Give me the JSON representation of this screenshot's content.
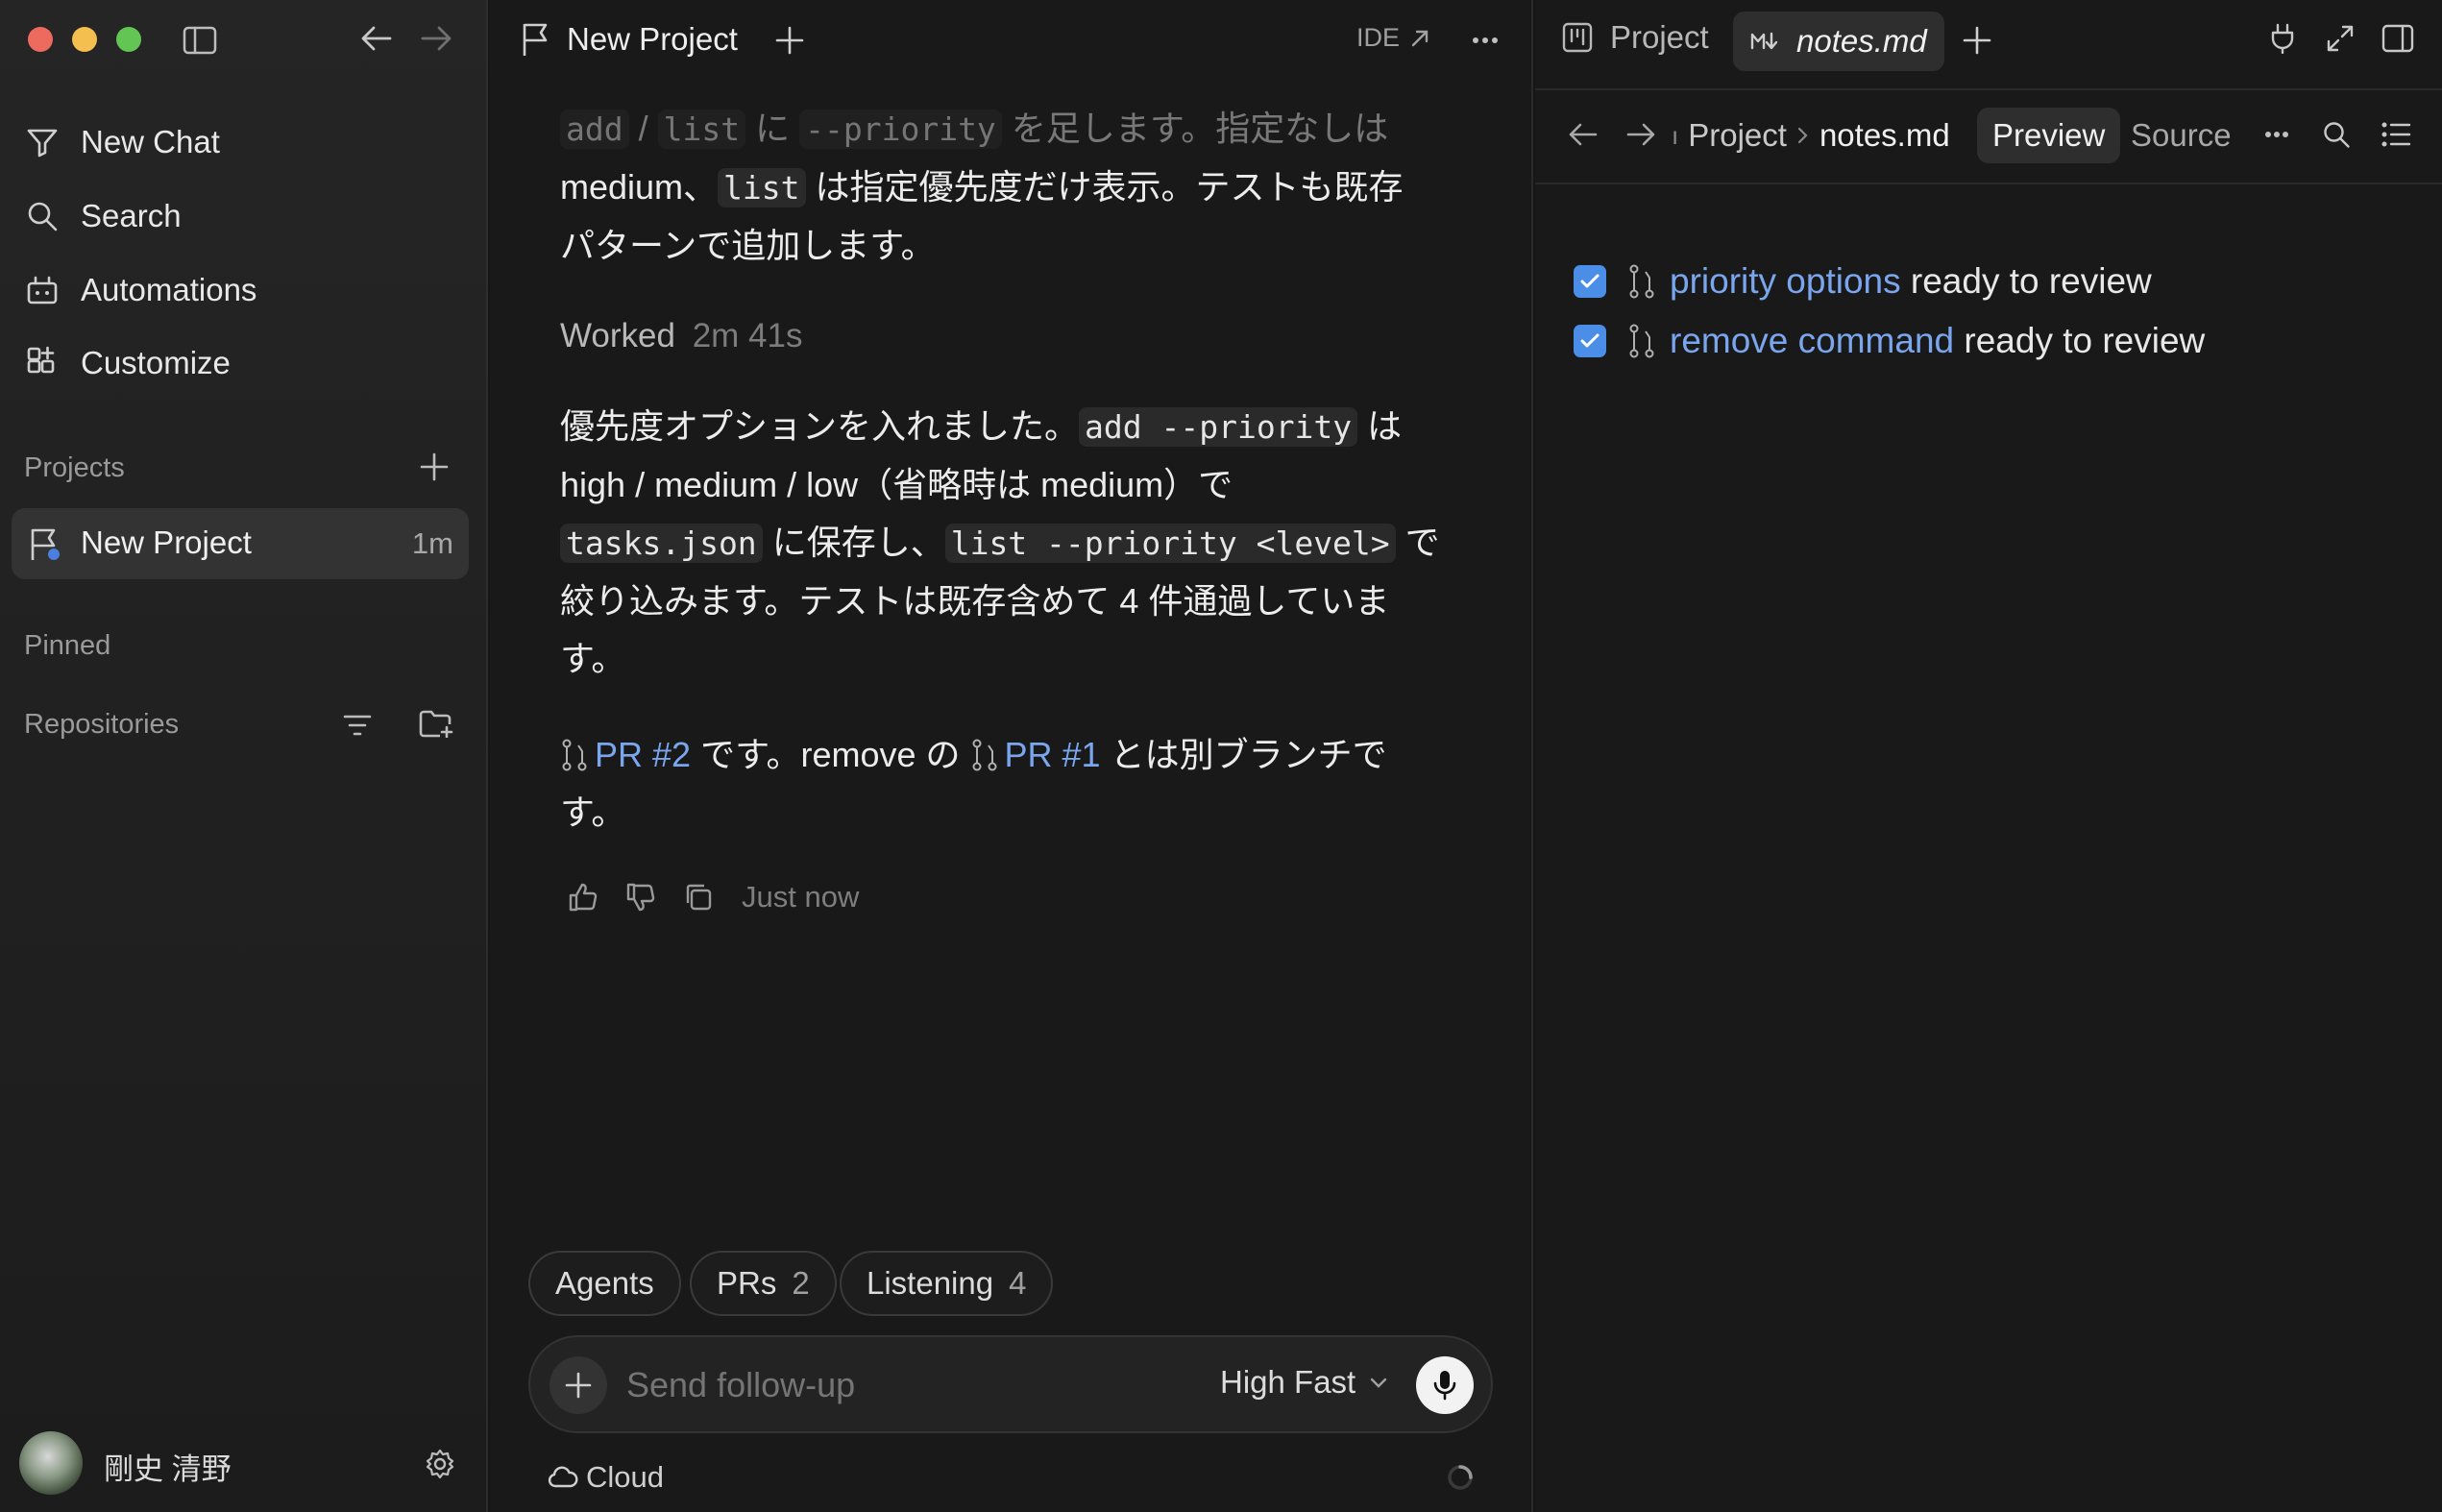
{
  "sidebar": {
    "nav": [
      {
        "label": "New Chat",
        "icon": "filter-icon"
      },
      {
        "label": "Search",
        "icon": "search-icon"
      },
      {
        "label": "Automations",
        "icon": "robot-icon"
      },
      {
        "label": "Customize",
        "icon": "grid-plus-icon"
      }
    ],
    "projects_label": "Projects",
    "project": {
      "name": "New Project",
      "time": "1m"
    },
    "pinned_label": "Pinned",
    "repositories_label": "Repositories",
    "user_name": "剛史 清野"
  },
  "chat": {
    "title": "New Project",
    "ide_label": "IDE",
    "msg1": {
      "p1a_code1": "add",
      "p1a_sep": " / ",
      "p1a_code2": "list",
      "p1a_t1": " に ",
      "p1a_code3": "--priority",
      "p1a_t2": " を足します。指定なしは",
      "p1b_t1": "medium、",
      "p1b_code": "list",
      "p1b_t2": " は指定優先度だけ表示。テストも既存",
      "p1c": "パターンで追加します。"
    },
    "worked_label": "Worked",
    "worked_time": "2m 41s",
    "msg2": {
      "l1_t1": "優先度オプションを入れました。",
      "l1_code": "add --priority",
      "l1_t2": " は",
      "l2": "high / medium / low（省略時は medium）で",
      "l3_code1": "tasks.json",
      "l3_t1": " に保存し、",
      "l3_code2": "list --priority <level>",
      "l3_t2": " で",
      "l4": "絞り込みます。テストは既存含めて 4 件通過していま",
      "l5": "す。"
    },
    "msg3": {
      "link1": "PR #2",
      "t1": " です。remove の ",
      "link2": "PR #1",
      "t2": " とは別ブランチで",
      "l2": "す。"
    },
    "timestamp": "Just now",
    "pills": [
      {
        "label": "Agents",
        "count": ""
      },
      {
        "label": "PRs",
        "count": "2"
      },
      {
        "label": "Listening",
        "count": "4"
      }
    ],
    "composer": {
      "placeholder": "Send follow-up",
      "model": "High Fast"
    },
    "env_label": "Cloud"
  },
  "panel": {
    "tab1": "Project",
    "tab2": "notes.md",
    "breadcrumb_parent": "Project",
    "breadcrumb_file": "notes.md",
    "preview_label": "Preview",
    "source_label": "Source",
    "todos": [
      {
        "link": "priority options",
        "text": " ready to review",
        "checked": true
      },
      {
        "link": "remove command",
        "text": " ready to review",
        "checked": true
      }
    ]
  },
  "colors": {
    "accent_link": "#7aa6ee",
    "checkbox": "#4a8ee8",
    "project_dot": "#4a7fe0"
  }
}
